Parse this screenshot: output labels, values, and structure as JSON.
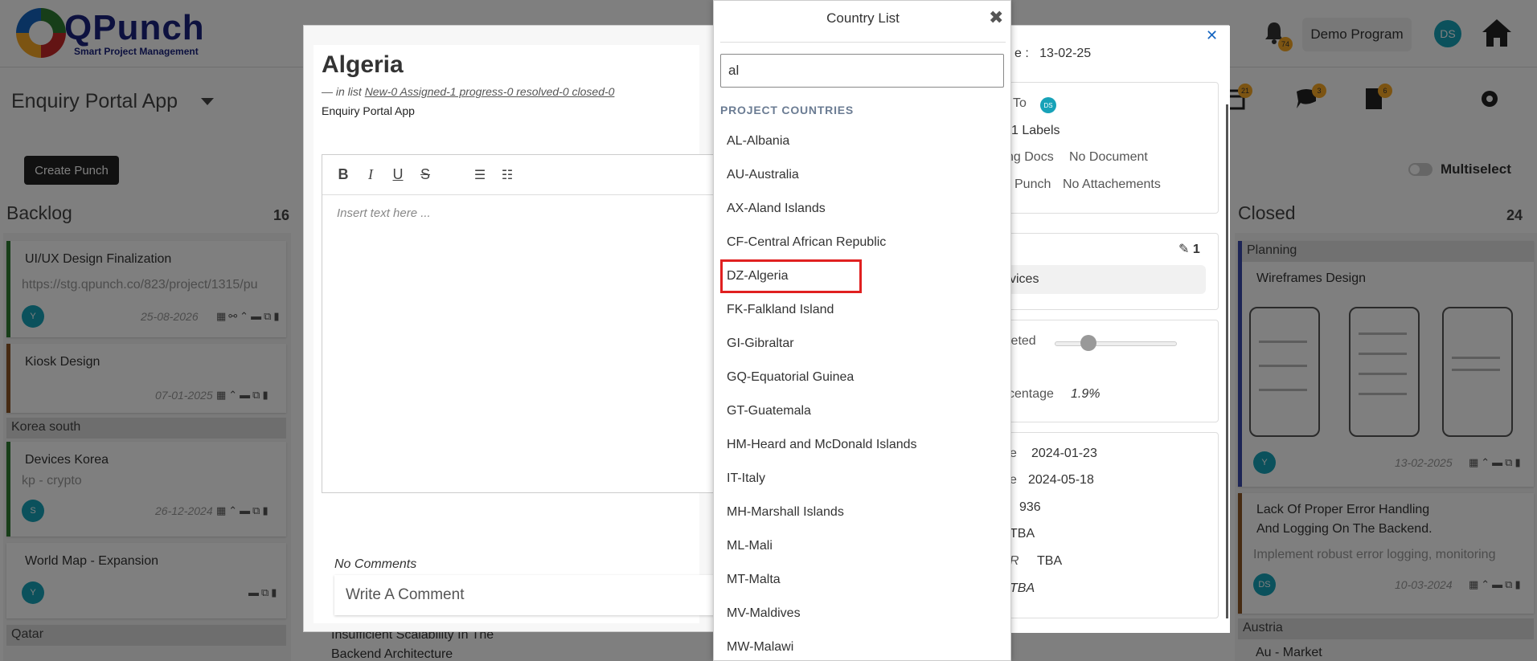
{
  "header": {
    "brand": "QPunch",
    "brand_sub": "Smart Project Management",
    "program": "Demo Program",
    "user_initials": "DS",
    "notifications_count": "74"
  },
  "toolbar_icons": {
    "badge_1": "21",
    "badge_2": "3",
    "badge_3": "6"
  },
  "app": {
    "title": "Enquiry Portal App",
    "create_button": "Create Punch",
    "multiselect": "Multiselect"
  },
  "columns": {
    "backlog": {
      "title": "Backlog",
      "count": "16"
    },
    "closed": {
      "title": "Closed",
      "count": "24"
    }
  },
  "backlog_cards": [
    {
      "title": "UI/UX Design Finalization",
      "sub": "https://stg.qpunch.co/823/project/1315/pu",
      "date": "25-08-2026",
      "avatar": "Y"
    },
    {
      "title": "Kiosk Design",
      "date": "07-01-2025"
    },
    {
      "group": "Korea south"
    },
    {
      "title": "Devices Korea",
      "sub": "kp - crypto",
      "date": "26-12-2024",
      "avatar": "S"
    },
    {
      "title": "World Map - Expansion",
      "avatar": "Y"
    },
    {
      "group": "Qatar"
    }
  ],
  "closed_cards": [
    {
      "group": "Planning",
      "title": "Wireframes Design",
      "date": "13-02-2025",
      "avatar": "Y"
    },
    {
      "title_line1": "Lack Of Proper Error Handling",
      "title_line2": "And Logging On The Backend.",
      "sub": "Implement robust error logging, monitoring",
      "date": "10-03-2024",
      "avatar": "DS"
    },
    {
      "group": "Austria",
      "title": "Au - Market"
    }
  ],
  "middle_partial": {
    "line1": "Insufficient Scalability In The",
    "line2": "Backend Architecture"
  },
  "modal": {
    "title": "Algeria",
    "in_list_prefix": "— in list",
    "in_list_link": "New-0 Assigned-1 progress-0 resolved-0 closed-0",
    "app_name": "Enquiry Portal App",
    "editor_placeholder": "Insert text here ...",
    "no_comments": "No Comments",
    "comment_placeholder": "Write A Comment",
    "right": {
      "date_label": "e :",
      "date_value": "13-02-25",
      "assigned_label": "To",
      "assigned_initials": "DS",
      "labels": "1 Labels",
      "docs_label": "ng Docs",
      "docs_value": "No Document",
      "punch_label": "Punch",
      "punch_value": "No Attachements",
      "edit_count": "1",
      "service": "vices",
      "completed_label": "leted",
      "completed_percent": 0.22,
      "percentage_label": "centage",
      "percentage_value": "1.9%",
      "start_label": "e",
      "start_value": "2024-01-23",
      "end_label": "e",
      "end_value": "2024-05-18",
      "num_value": "936",
      "tba1": "TBA",
      "r_label": "R",
      "tba2": "TBA",
      "tba3": "TBA"
    }
  },
  "country_list": {
    "title": "Country List",
    "search_value": "al",
    "section": "PROJECT COUNTRIES",
    "items": [
      "AL-Albania",
      "AU-Australia",
      "AX-Aland Islands",
      "CF-Central African Republic",
      "DZ-Algeria",
      "FK-Falkland Island",
      "GI-Gibraltar",
      "GQ-Equatorial Guinea",
      "GT-Guatemala",
      "HM-Heard and McDonald Islands",
      "IT-Italy",
      "MH-Marshall Islands",
      "ML-Mali",
      "MT-Malta",
      "MV-Maldives",
      "MW-Malawi"
    ],
    "highlighted_item": "DZ-Algeria"
  },
  "colors": {
    "accent_teal": "#17a2b8",
    "badge_yellow": "#f9a825",
    "highlight_red": "#e02020",
    "brand_navy": "#1a237e"
  }
}
